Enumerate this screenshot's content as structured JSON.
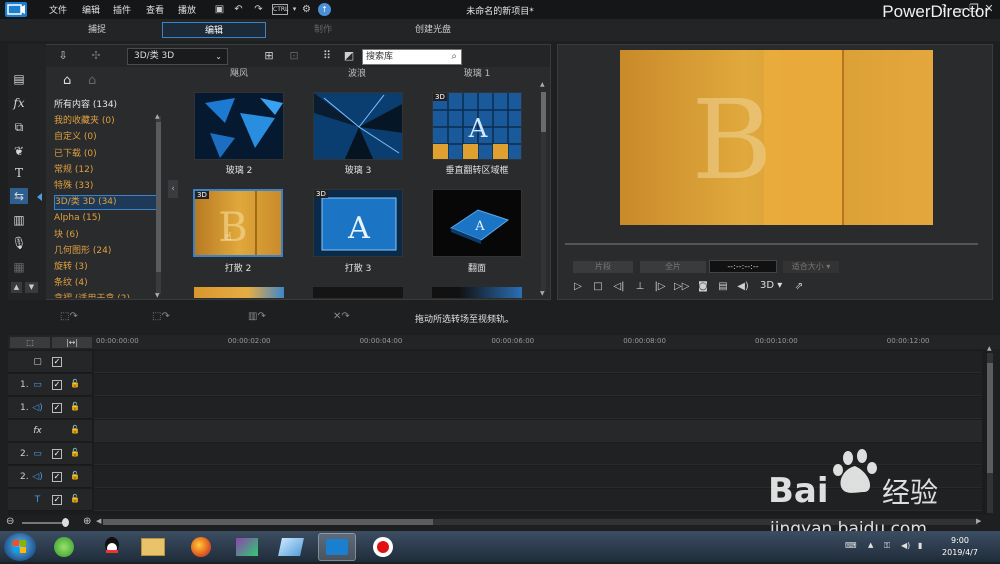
{
  "app": {
    "title": "未命名的新项目*",
    "brand": "PowerDirector",
    "menu": [
      "文件",
      "编辑",
      "插件",
      "查看",
      "播放"
    ],
    "ctrl_label": "CTRL",
    "window_controls": [
      "?",
      "—",
      "❐",
      "✕"
    ]
  },
  "modes": {
    "capture": "捕捉",
    "edit": "编辑",
    "produce": "制作",
    "create_disc": "创建光盘"
  },
  "library": {
    "category_selected": "3D/类 3D",
    "search_placeholder": "搜索库",
    "categories": [
      {
        "label": "所有内容 (134)",
        "color": "white"
      },
      {
        "label": "我的收藏夹 (0)",
        "color": "orange"
      },
      {
        "label": "自定义 (0)",
        "color": "orange"
      },
      {
        "label": "已下载 (0)",
        "color": "orange"
      },
      {
        "label": "常规 (12)",
        "color": "orange"
      },
      {
        "label": "特殊 (33)",
        "color": "orange"
      },
      {
        "label": "3D/类 3D (34)",
        "color": "orange",
        "selected": true
      },
      {
        "label": "Alpha (15)",
        "color": "orange"
      },
      {
        "label": "块 (6)",
        "color": "orange"
      },
      {
        "label": "几何图形 (24)",
        "color": "orange"
      },
      {
        "label": "旋转 (3)",
        "color": "orange"
      },
      {
        "label": "条纹 (4)",
        "color": "orange"
      },
      {
        "label": "拿褶 (适用于拿 (2)",
        "color": "orange"
      }
    ],
    "top_row_labels": [
      "飓风",
      "波浪",
      "玻璃 1"
    ],
    "items": [
      {
        "label": "玻璃 2",
        "badge": ""
      },
      {
        "label": "玻璃 3",
        "badge": ""
      },
      {
        "label": "垂直翻转区域框",
        "badge": "3D"
      },
      {
        "label": "打散 2",
        "badge": "3D"
      },
      {
        "label": "打散 3",
        "badge": "3D"
      },
      {
        "label": "翻面",
        "badge": ""
      }
    ]
  },
  "preview": {
    "clip_btn": "片段",
    "movie_btn": "全片",
    "timecode": "--:--:--:--",
    "fit_label": "适合大小",
    "mode_3d": "3D"
  },
  "editbar": {
    "hint": "拖动所选转场至视频轨。"
  },
  "timeline": {
    "ticks": [
      "00:00:00:00",
      "00:00:02:00",
      "00:00:04:00",
      "00:00:06:00",
      "00:00:08:00",
      "00:00:10:00",
      "00:00:12:00"
    ],
    "tracks": [
      {
        "num": "",
        "icon": "master-icon",
        "kind": "master"
      },
      {
        "num": "1.",
        "icon": "video-icon",
        "kind": "video"
      },
      {
        "num": "1.",
        "icon": "audio-icon",
        "kind": "audio"
      },
      {
        "num": "",
        "icon": "fx-icon",
        "kind": "fx"
      },
      {
        "num": "2.",
        "icon": "video-icon",
        "kind": "video"
      },
      {
        "num": "2.",
        "icon": "audio-icon",
        "kind": "audio"
      },
      {
        "num": "",
        "icon": "title-icon",
        "kind": "title"
      }
    ]
  },
  "taskbar": {
    "time": "9:00",
    "date": "2019/4/7"
  },
  "watermark": {
    "line1": "Bai",
    "line1b": "经验",
    "line2": "jingyan.baidu.com"
  },
  "colors": {
    "accent": "#3b83c6",
    "category_orange": "#e0a040",
    "preview_gold": "#e0a93d"
  }
}
